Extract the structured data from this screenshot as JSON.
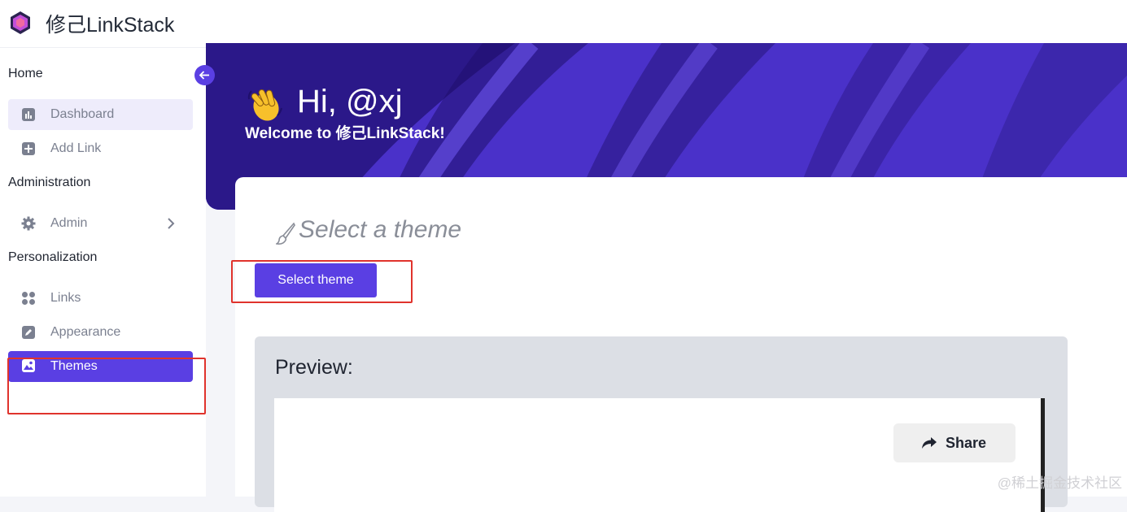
{
  "brand": {
    "name": "修己LinkStack",
    "logo_icon": "gem-logo-icon"
  },
  "sidebar": {
    "sections": [
      {
        "title": "Home"
      },
      {
        "title": "Administration"
      },
      {
        "title": "Personalization"
      }
    ],
    "items": [
      {
        "label": "Dashboard",
        "icon": "chart-icon"
      },
      {
        "label": "Add Link",
        "icon": "plus-square-icon"
      },
      {
        "label": "Admin",
        "icon": "gear-icon"
      },
      {
        "label": "Links",
        "icon": "grid-icon"
      },
      {
        "label": "Appearance",
        "icon": "edit-icon"
      },
      {
        "label": "Themes",
        "icon": "image-icon"
      }
    ],
    "active_item": "Themes",
    "collapse_icon": "arrow-left-icon"
  },
  "hero": {
    "greeting": "Hi, @xj",
    "welcome": "Welcome to 修己LinkStack!",
    "wave_icon": "waving-hand-icon"
  },
  "card": {
    "title": "Select a theme",
    "title_icon": "brush-icon",
    "select_button": "Select theme",
    "preview_label": "Preview:",
    "share_button": "Share"
  },
  "watermark": "@稀土掘金技术社区",
  "colors": {
    "accent": "#5a3fe3",
    "annotation": "#e0332c",
    "hero_dark": "#1f0f6b"
  }
}
